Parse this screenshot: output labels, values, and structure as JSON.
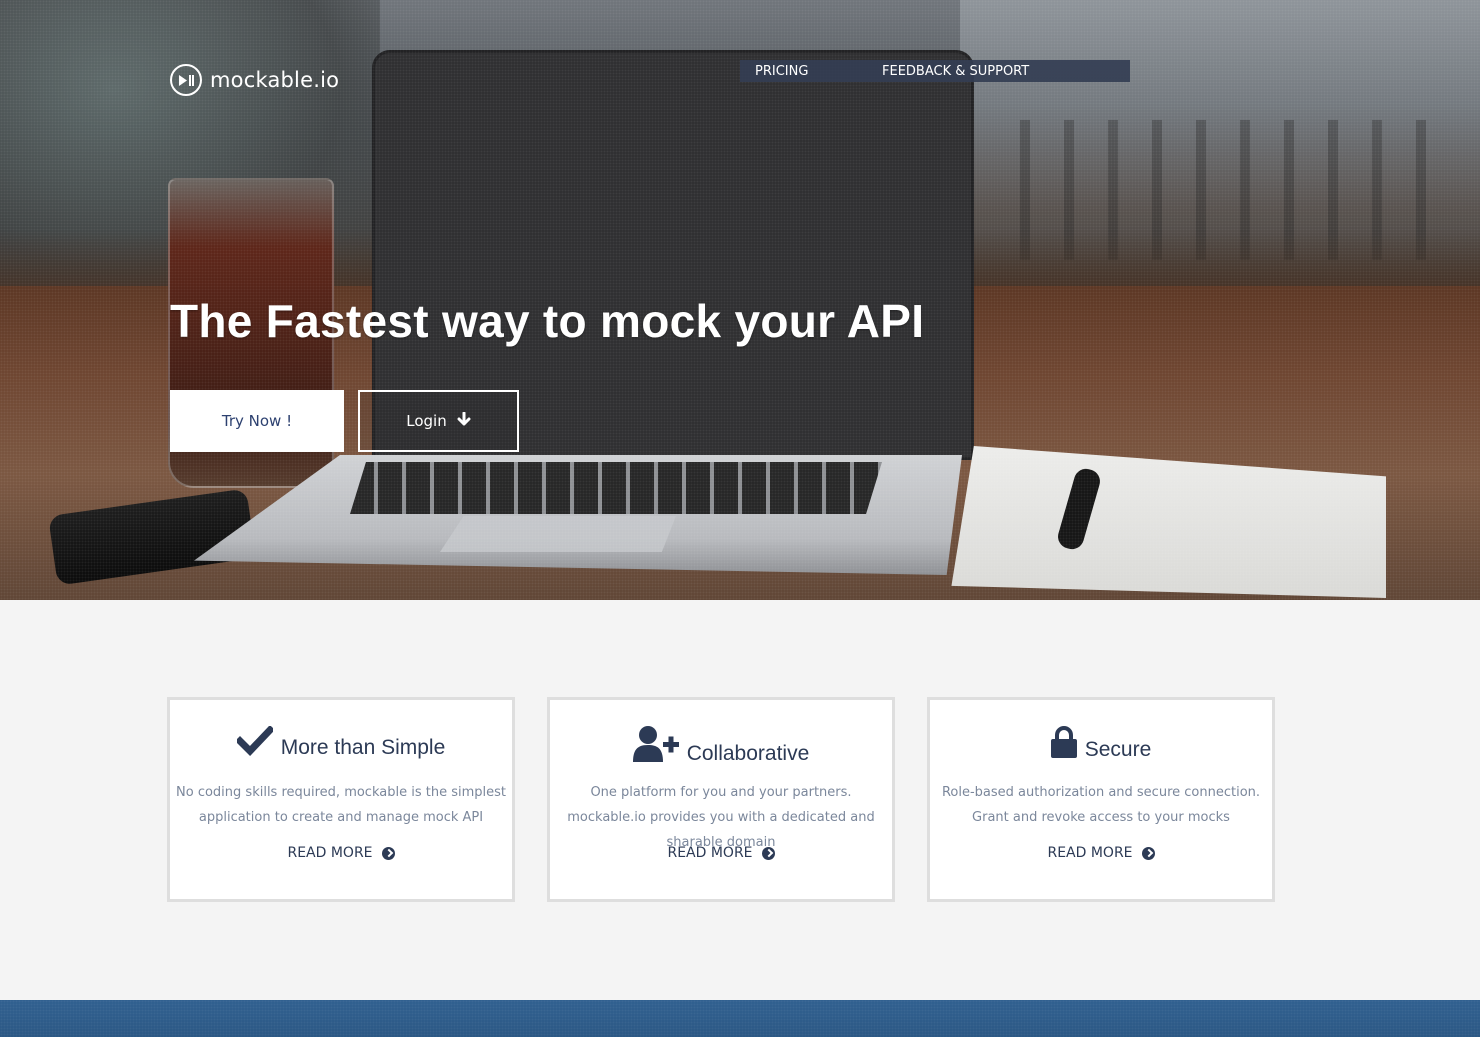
{
  "brand": {
    "name": "mockable.io",
    "logo_icon": "play-pause-icon"
  },
  "nav": {
    "items": [
      {
        "label": "PRICING"
      },
      {
        "label": "FEEDBACK & SUPPORT"
      }
    ],
    "bg_color": "#343e54"
  },
  "hero": {
    "headline": "The Fastest way to mock your API",
    "try_button": "Try Now !",
    "login_button": "Login",
    "login_icon": "arrow-down-icon"
  },
  "features": [
    {
      "icon": "checkmark-icon",
      "title": "More than Simple",
      "description": "No coding skills required, mockable is the simplest application to create and manage mock API",
      "link": "READ MORE"
    },
    {
      "icon": "add-user-icon",
      "title": "Collaborative",
      "description": "One platform for you and your partners. mockable.io provides you with a dedicated and sharable domain",
      "link": "READ MORE"
    },
    {
      "icon": "lock-icon",
      "title": "Secure",
      "description": "Role-based authorization and secure connection. Grant and revoke access to your mocks",
      "link": "READ MORE"
    }
  ],
  "colors": {
    "accent": "#2c3a55",
    "footer": "#2d5a88",
    "page_bg": "#f4f4f4"
  }
}
